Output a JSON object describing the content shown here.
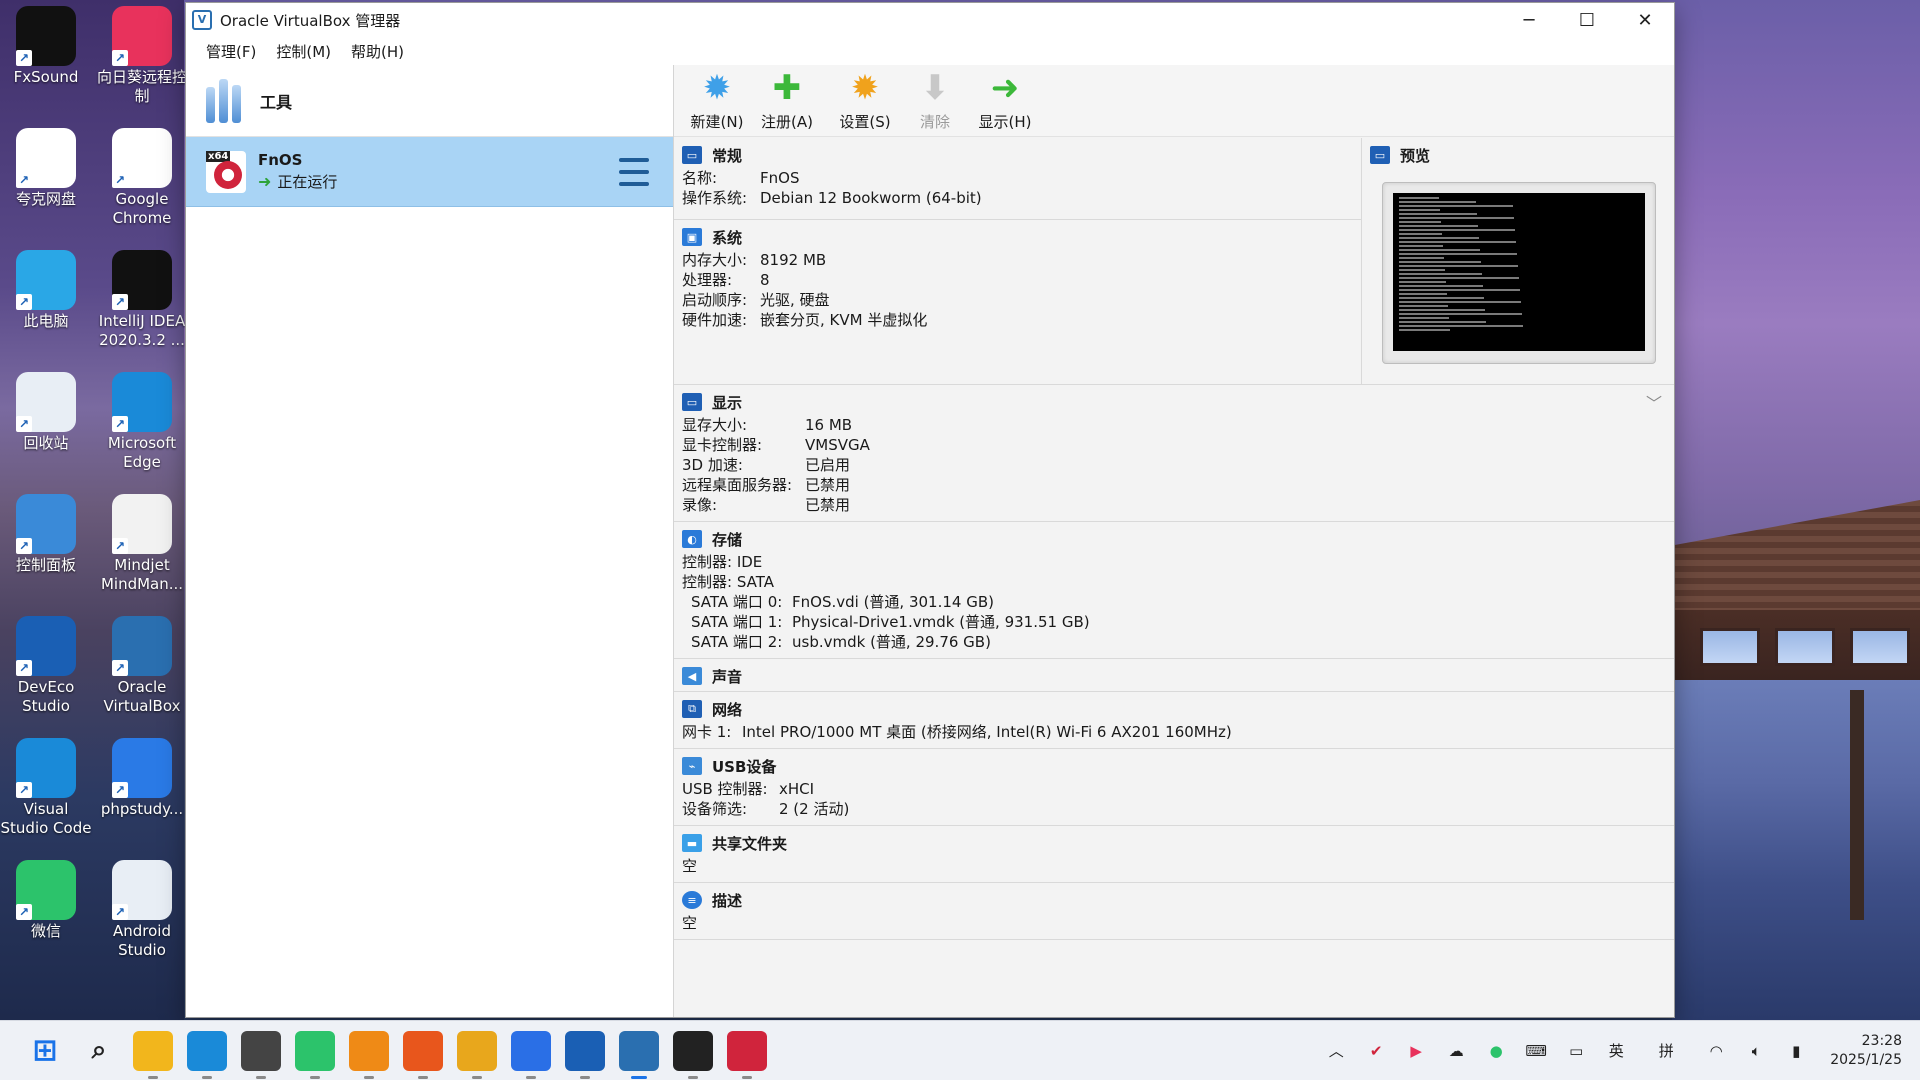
{
  "desktop": {
    "icons": [
      {
        "label": "FxSound",
        "icon": "fxsound-icon",
        "color": "#111111"
      },
      {
        "label": "向日葵远程控制",
        "icon": "sunflower-remote-icon",
        "color": "#e8325c"
      },
      {
        "label": "夸克网盘",
        "icon": "quark-cloud-icon",
        "color": "#ffffff"
      },
      {
        "label": "Google Chrome",
        "icon": "chrome-icon",
        "color": "#ffffff"
      },
      {
        "label": "此电脑",
        "icon": "this-pc-icon",
        "color": "#2aa7e6"
      },
      {
        "label": "IntelliJ IDEA 2020.3.2 ...",
        "icon": "intellij-icon",
        "color": "#111111"
      },
      {
        "label": "回收站",
        "icon": "recycle-bin-icon",
        "color": "#e8eef5"
      },
      {
        "label": "Microsoft Edge",
        "icon": "edge-icon",
        "color": "#1a8ad8"
      },
      {
        "label": "控制面板",
        "icon": "control-panel-icon",
        "color": "#3a8ad8"
      },
      {
        "label": "Mindjet MindMan...",
        "icon": "mindjet-icon",
        "color": "#f2f2f2"
      },
      {
        "label": "DevEco Studio",
        "icon": "deveco-icon",
        "color": "#1a5fb4"
      },
      {
        "label": "Oracle VirtualBox",
        "icon": "virtualbox-icon",
        "color": "#2a6fb0"
      },
      {
        "label": "Visual Studio Code",
        "icon": "vscode-icon",
        "color": "#1a8ad8"
      },
      {
        "label": "phpstudy...",
        "icon": "phpstudy-icon",
        "color": "#2a7ae6"
      },
      {
        "label": "微信",
        "icon": "wechat-icon",
        "color": "#2cc36b"
      },
      {
        "label": "Android Studio",
        "icon": "android-studio-icon",
        "color": "#e8eef5"
      }
    ]
  },
  "window": {
    "title": "Oracle VirtualBox 管理器",
    "minimize": "─",
    "maximize": "☐",
    "close": "✕"
  },
  "menu": [
    "管理(F)",
    "控制(M)",
    "帮助(H)"
  ],
  "left": {
    "tools_label": "工具",
    "vm": {
      "badge": "x64",
      "name": "FnOS",
      "state": "正在运行"
    }
  },
  "toolbar": [
    {
      "label": "新建(N)",
      "icon": "new-gear-icon",
      "enabled": true
    },
    {
      "label": "注册(A)",
      "icon": "add-plus-icon",
      "enabled": true
    },
    {
      "label": "设置(S)",
      "icon": "settings-gear-icon",
      "enabled": true
    },
    {
      "label": "清除",
      "icon": "discard-arrow-icon",
      "enabled": false
    },
    {
      "label": "显示(H)",
      "icon": "show-arrow-icon",
      "enabled": true
    }
  ],
  "details": {
    "general": {
      "title": "常规",
      "rows": [
        [
          "名称:",
          "FnOS"
        ],
        [
          "操作系统:",
          "Debian 12 Bookworm (64-bit)"
        ]
      ]
    },
    "preview": {
      "title": "预览"
    },
    "system": {
      "title": "系统",
      "rows": [
        [
          "内存大小:",
          "8192 MB"
        ],
        [
          "处理器:",
          "8"
        ],
        [
          "启动顺序:",
          "光驱, 硬盘"
        ],
        [
          "硬件加速:",
          "嵌套分页, KVM 半虚拟化"
        ]
      ]
    },
    "display": {
      "title": "显示",
      "rows": [
        [
          "显存大小:",
          "16 MB"
        ],
        [
          "显卡控制器:",
          "VMSVGA"
        ],
        [
          "3D 加速:",
          "已启用"
        ],
        [
          "远程桌面服务器:",
          "已禁用"
        ],
        [
          "录像:",
          "已禁用"
        ]
      ]
    },
    "storage": {
      "title": "存储",
      "rows": [
        [
          "控制器: IDE",
          ""
        ],
        [
          "控制器: SATA",
          ""
        ],
        [
          "  SATA 端口 0:",
          "FnOS.vdi (普通, 301.14 GB)"
        ],
        [
          "  SATA 端口 1:",
          "Physical-Drive1.vmdk (普通, 931.51 GB)"
        ],
        [
          "  SATA 端口 2:",
          "usb.vmdk (普通, 29.76 GB)"
        ]
      ]
    },
    "audio": {
      "title": "声音"
    },
    "network": {
      "title": "网络",
      "rows": [
        [
          "网卡 1:",
          "Intel PRO/1000 MT 桌面 (桥接网络, Intel(R) Wi-Fi 6 AX201 160MHz)"
        ]
      ]
    },
    "usb": {
      "title": "USB设备",
      "rows": [
        [
          "USB 控制器:",
          "xHCI"
        ],
        [
          "设备筛选:",
          "2 (2 活动)"
        ]
      ]
    },
    "shared": {
      "title": "共享文件夹",
      "value": "空"
    },
    "description": {
      "title": "描述",
      "value": "空"
    }
  },
  "taskbar": {
    "apps": [
      {
        "icon": "start-windows-icon",
        "color": "#1a73e8"
      },
      {
        "icon": "search-icon",
        "color": "#222222"
      },
      {
        "icon": "file-explorer-icon",
        "color": "#f2b61c"
      },
      {
        "icon": "edge-icon",
        "color": "#1a8ad8"
      },
      {
        "icon": "steam-like-icon",
        "color": "#444444"
      },
      {
        "icon": "wechat-icon",
        "color": "#2cc36b"
      },
      {
        "icon": "sublime-text-icon",
        "color": "#ef8a16"
      },
      {
        "icon": "firefox-icon",
        "color": "#e8561c"
      },
      {
        "icon": "chrome-icon",
        "color": "#e8a71c"
      },
      {
        "icon": "edge-dev-icon",
        "color": "#2a6fe6"
      },
      {
        "icon": "vscode-like-icon",
        "color": "#1a5fb4"
      },
      {
        "icon": "virtualbox-icon",
        "color": "#2a6fb0"
      },
      {
        "icon": "terminal-icon",
        "color": "#222222"
      },
      {
        "icon": "fnos-vm-icon",
        "color": "#d0243c"
      }
    ],
    "tray": {
      "lang": "英",
      "ime": "拼",
      "time": "23:28",
      "date": "2025/1/25"
    }
  }
}
